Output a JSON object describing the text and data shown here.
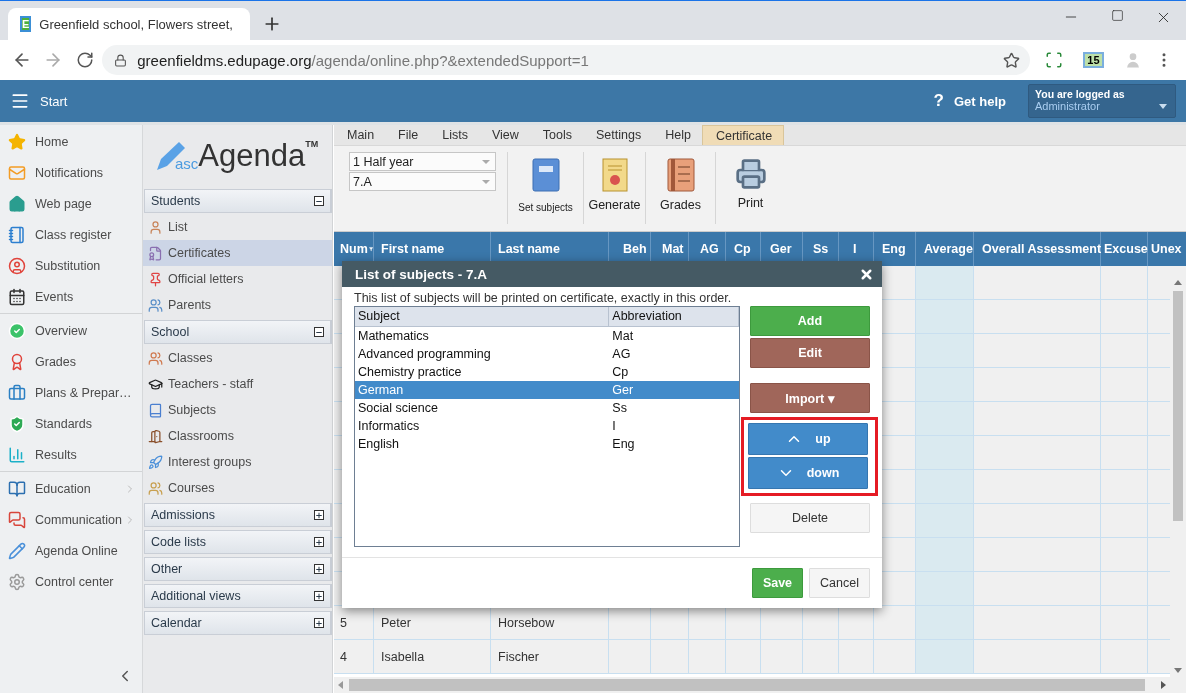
{
  "browser": {
    "favicon": "E",
    "tab_title": "Greenfield school, Flowers street,",
    "url_host": "greenfieldms.edupage.org",
    "url_path": "/agenda/online.php?&extendedSupport=1",
    "extension_badge": "15"
  },
  "app_bar": {
    "title": "Start",
    "help_glyph": "?",
    "help": "Get help",
    "login_caption": "You are logged as",
    "login_user": "Administrator"
  },
  "nav": {
    "groups": [
      {
        "items": [
          {
            "label": "Home",
            "submenu": false
          },
          {
            "label": "Notifications",
            "submenu": false
          },
          {
            "label": "Web page",
            "submenu": false
          },
          {
            "label": "Class register",
            "submenu": false
          },
          {
            "label": "Substitution",
            "submenu": false
          },
          {
            "label": "Events",
            "submenu": false
          }
        ]
      },
      {
        "items": [
          {
            "label": "Overview",
            "submenu": false
          },
          {
            "label": "Grades",
            "submenu": false
          },
          {
            "label": "Plans & Prepar…",
            "submenu": false
          },
          {
            "label": "Standards",
            "submenu": false
          },
          {
            "label": "Results",
            "submenu": false
          }
        ]
      },
      {
        "items": [
          {
            "label": "Education",
            "submenu": true
          },
          {
            "label": "Communication",
            "submenu": true
          },
          {
            "label": "Agenda Online",
            "submenu": false
          },
          {
            "label": "Control center",
            "submenu": false
          }
        ]
      }
    ]
  },
  "sidebar": {
    "logo": {
      "prefix": "asc",
      "name": "Agenda",
      "mark": "TM"
    },
    "sections": [
      {
        "title": "Students",
        "expanded": true,
        "items": [
          {
            "label": "List",
            "selected": false
          },
          {
            "label": "Certificates",
            "selected": true
          },
          {
            "label": "Official letters",
            "selected": false
          },
          {
            "label": "Parents",
            "selected": false
          }
        ]
      },
      {
        "title": "School",
        "expanded": true,
        "items": [
          {
            "label": "Classes",
            "selected": false
          },
          {
            "label": "Teachers - staff",
            "selected": false
          },
          {
            "label": "Subjects",
            "selected": false
          },
          {
            "label": "Classrooms",
            "selected": false
          },
          {
            "label": "Interest groups",
            "selected": false
          },
          {
            "label": "Courses",
            "selected": false
          }
        ]
      },
      {
        "title": "Admissions",
        "expanded": false
      },
      {
        "title": "Code lists",
        "expanded": false
      },
      {
        "title": "Other",
        "expanded": false
      },
      {
        "title": "Additional views",
        "expanded": false
      },
      {
        "title": "Calendar",
        "expanded": false
      }
    ]
  },
  "menu_tabs": [
    {
      "label": "Main",
      "selected": false
    },
    {
      "label": "File",
      "selected": false
    },
    {
      "label": "Lists",
      "selected": false
    },
    {
      "label": "View",
      "selected": false
    },
    {
      "label": "Tools",
      "selected": false
    },
    {
      "label": "Settings",
      "selected": false
    },
    {
      "label": "Help",
      "selected": false
    },
    {
      "label": "Certificate",
      "selected": true
    }
  ],
  "toolbar": {
    "selects": [
      "1 Half year",
      "7.A"
    ],
    "actions": [
      "Set subjects",
      "Generate",
      "Grades",
      "Print"
    ]
  },
  "grid": {
    "columns": [
      {
        "label": "Num",
        "highlighted": false
      },
      {
        "label": "First name",
        "highlighted": false
      },
      {
        "label": "Last name",
        "highlighted": false
      },
      {
        "label": "Beh",
        "highlighted": false
      },
      {
        "label": "Mat",
        "highlighted": false
      },
      {
        "label": "AG",
        "highlighted": false
      },
      {
        "label": "Cp",
        "highlighted": false
      },
      {
        "label": "Ger",
        "highlighted": false
      },
      {
        "label": "Ss",
        "highlighted": false
      },
      {
        "label": "I",
        "highlighted": false
      },
      {
        "label": "Eng",
        "highlighted": false
      },
      {
        "label": "Average",
        "highlighted": true
      },
      {
        "label": "Overall Assessment",
        "highlighted": false
      },
      {
        "label": "Excuse",
        "highlighted": false
      },
      {
        "label": "Unex",
        "highlighted": false
      }
    ],
    "rows": [
      {
        "num": "5",
        "first_name": "Peter",
        "last_name": "Horsebow"
      },
      {
        "num": "4",
        "first_name": "Isabella",
        "last_name": "Fischer"
      }
    ]
  },
  "dialog": {
    "title": "List of subjects - 7.A",
    "description": "This list of subjects will be printed on certificate, exactly in this order.",
    "columns": [
      "Subject",
      "Abbreviation"
    ],
    "rows": [
      {
        "subject": "Mathematics",
        "abbreviation": "Mat",
        "selected": false
      },
      {
        "subject": "Advanced programming",
        "abbreviation": "AG",
        "selected": false
      },
      {
        "subject": "Chemistry practice",
        "abbreviation": "Cp",
        "selected": false
      },
      {
        "subject": "German",
        "abbreviation": "Ger",
        "selected": true
      },
      {
        "subject": "Social science",
        "abbreviation": "Ss",
        "selected": false
      },
      {
        "subject": "Informatics",
        "abbreviation": "I",
        "selected": false
      },
      {
        "subject": "English",
        "abbreviation": "Eng",
        "selected": false
      }
    ],
    "side_groups": [
      {
        "outlined": false,
        "buttons": [
          {
            "label": "Add",
            "kind": "add"
          },
          {
            "label": "Edit",
            "kind": "edit"
          }
        ]
      },
      {
        "outlined": false,
        "buttons": [
          {
            "label": "Import ▾",
            "kind": "import"
          }
        ]
      },
      {
        "outlined": true,
        "buttons": [
          {
            "label": "up",
            "kind": "up"
          },
          {
            "label": "down",
            "kind": "down"
          }
        ]
      },
      {
        "outlined": false,
        "buttons": [
          {
            "label": "Delete",
            "kind": "delete"
          }
        ]
      }
    ],
    "footer_buttons": [
      {
        "label": "Save",
        "kind": "primary"
      },
      {
        "label": "Cancel",
        "kind": "default"
      }
    ]
  }
}
